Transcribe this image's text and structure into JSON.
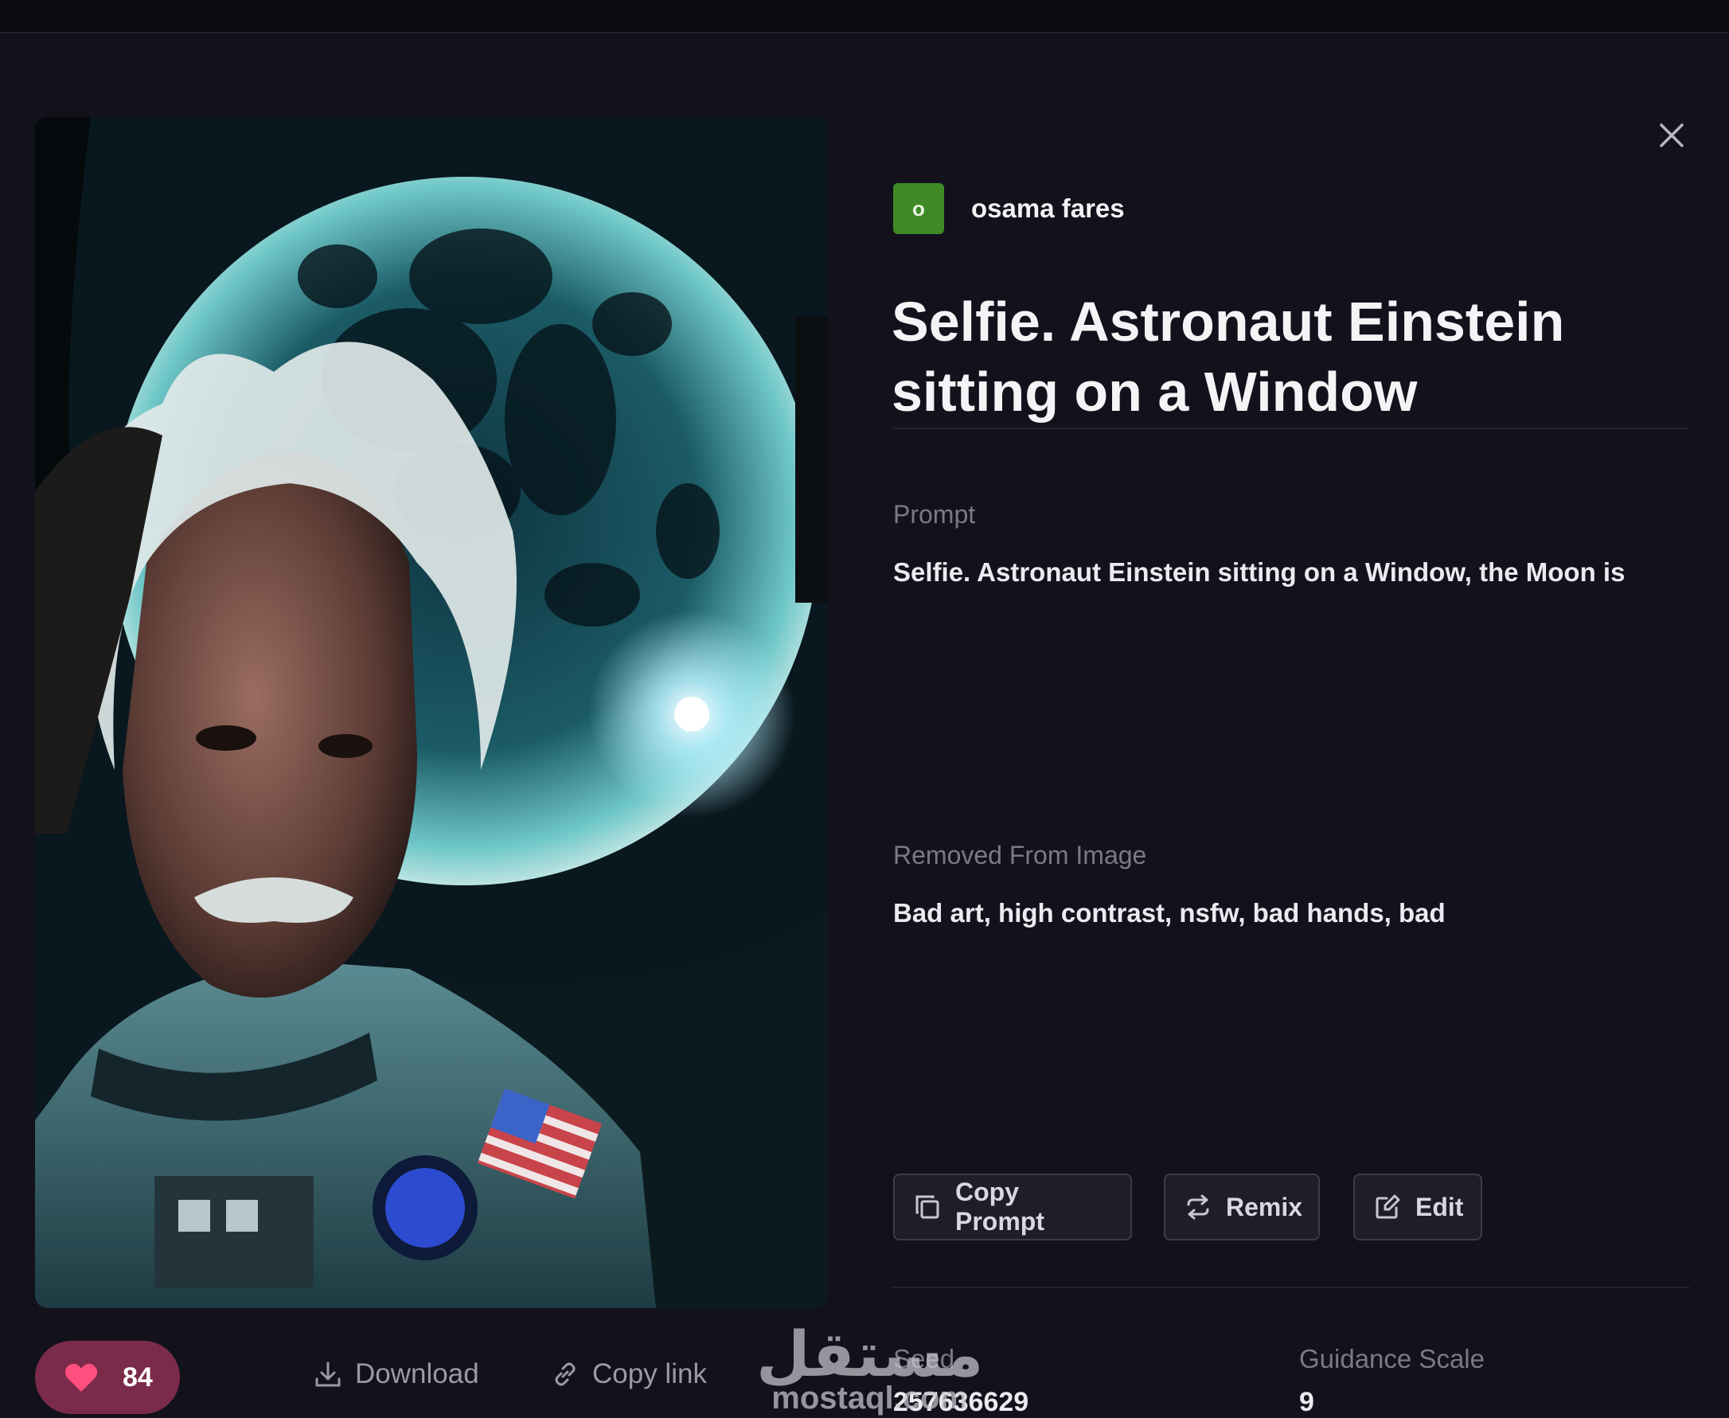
{
  "author": {
    "initial": "o",
    "name": "osama fares"
  },
  "title": "Selfie. Astronaut Einstein sitting on a Window",
  "prompt": {
    "label": "Prompt",
    "text": "Selfie. Astronaut Einstein sitting on a Window, the Moon is"
  },
  "removed": {
    "label": "Removed From Image",
    "text": "Bad art, high contrast, nsfw, bad hands, bad"
  },
  "actions": {
    "copy_prompt": "Copy Prompt",
    "remix": "Remix",
    "edit": "Edit"
  },
  "likes": {
    "count": "84"
  },
  "footer": {
    "download": "Download",
    "copy_link": "Copy link"
  },
  "meta": {
    "seed_label": "Seed",
    "seed_value": "257636629",
    "guidance_label": "Guidance Scale",
    "guidance_value": "9"
  },
  "watermark": {
    "arabic": "مستقل",
    "latin": "mostaql.com"
  },
  "colors": {
    "accent_like": "#7b2b4a",
    "avatar": "#3f8a26",
    "background": "#13121c"
  },
  "icons": [
    "close-icon",
    "copy-icon",
    "remix-icon",
    "edit-icon",
    "heart-icon",
    "download-icon",
    "link-icon"
  ]
}
